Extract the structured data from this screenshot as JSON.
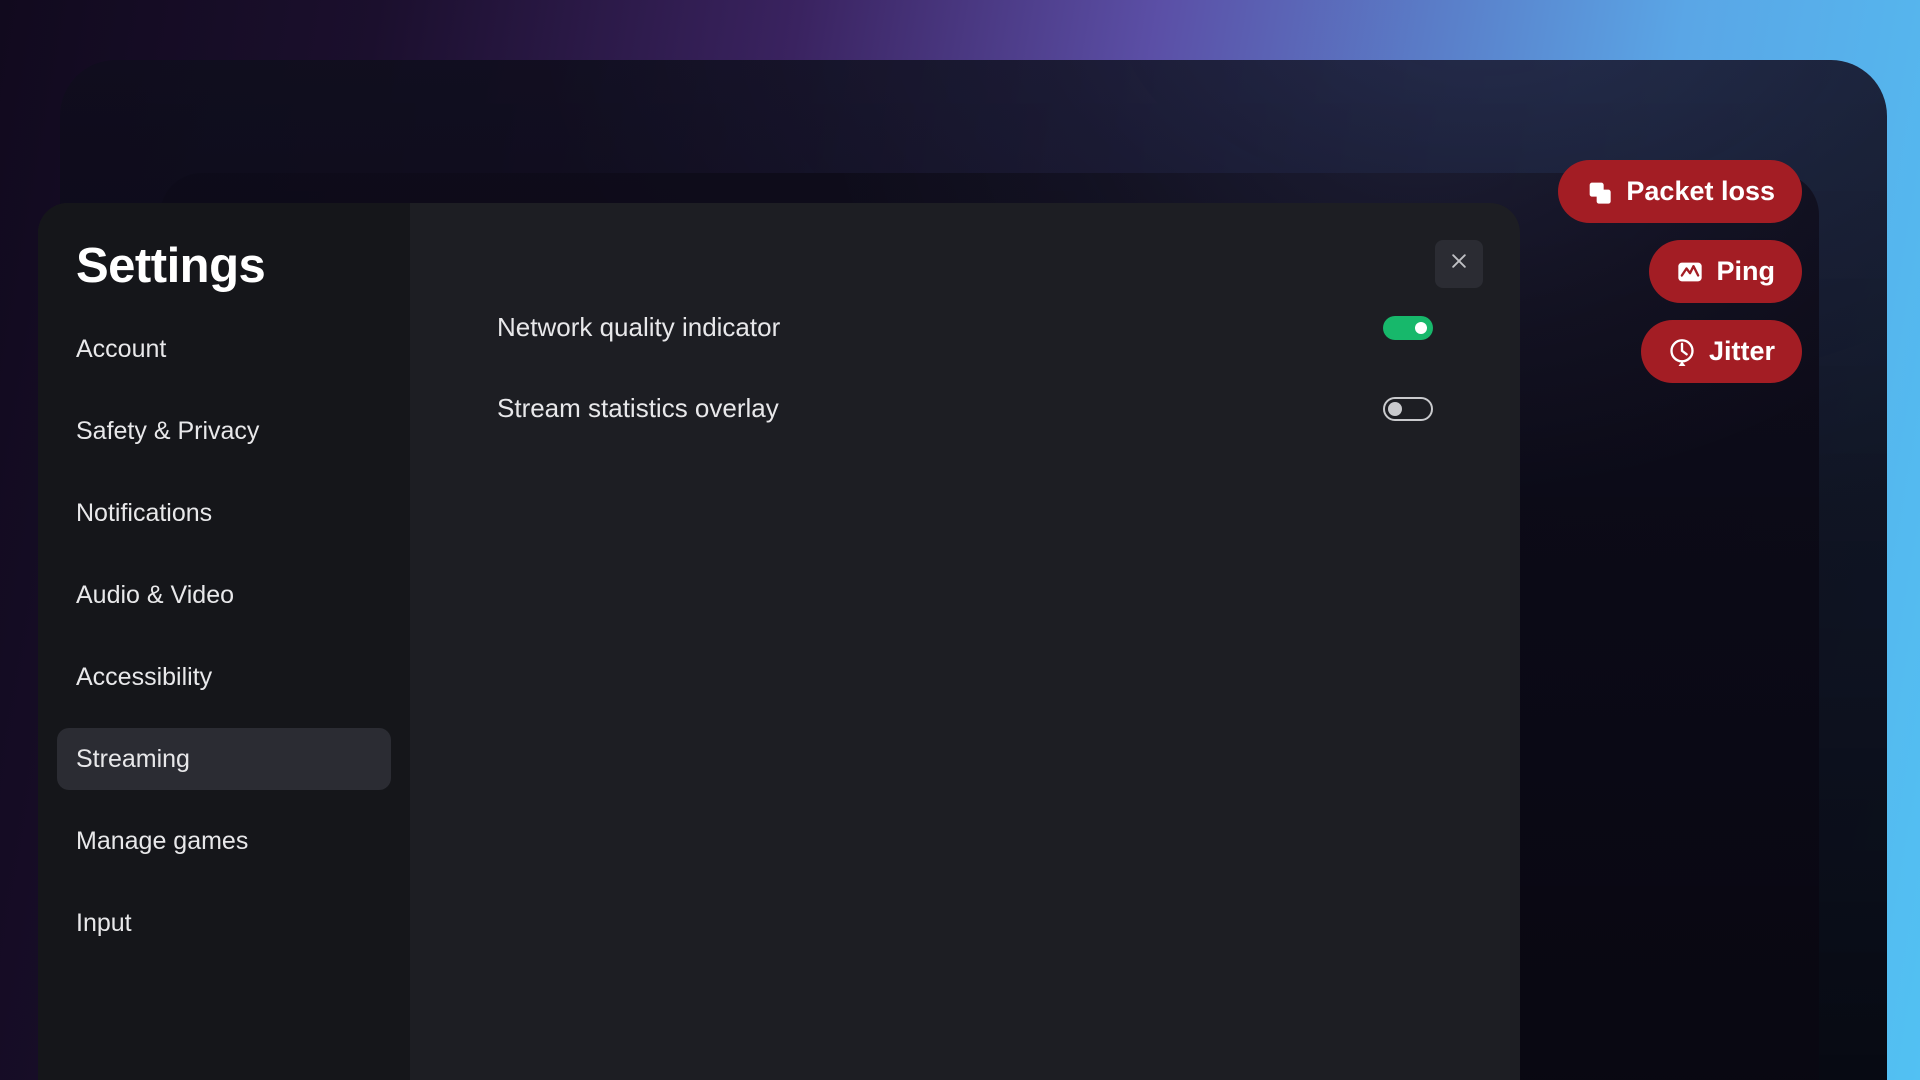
{
  "colors": {
    "pill_bg": "#a31d24",
    "toggle_on": "#17b86b"
  },
  "status": {
    "packet_loss": {
      "label": "Packet loss",
      "icon": "packet-loss-icon"
    },
    "ping": {
      "label": "Ping",
      "icon": "ping-icon"
    },
    "jitter": {
      "label": "Jitter",
      "icon": "jitter-icon"
    }
  },
  "settings": {
    "title": "Settings",
    "nav": {
      "selected_index": 5,
      "items": [
        {
          "label": "Account"
        },
        {
          "label": "Safety & Privacy"
        },
        {
          "label": "Notifications"
        },
        {
          "label": "Audio & Video"
        },
        {
          "label": "Accessibility"
        },
        {
          "label": "Streaming"
        },
        {
          "label": "Manage games"
        },
        {
          "label": "Input"
        }
      ]
    },
    "streaming": {
      "network_quality": {
        "label": "Network quality indicator",
        "value": true
      },
      "stats_overlay": {
        "label": "Stream statistics overlay",
        "value": false
      }
    }
  }
}
